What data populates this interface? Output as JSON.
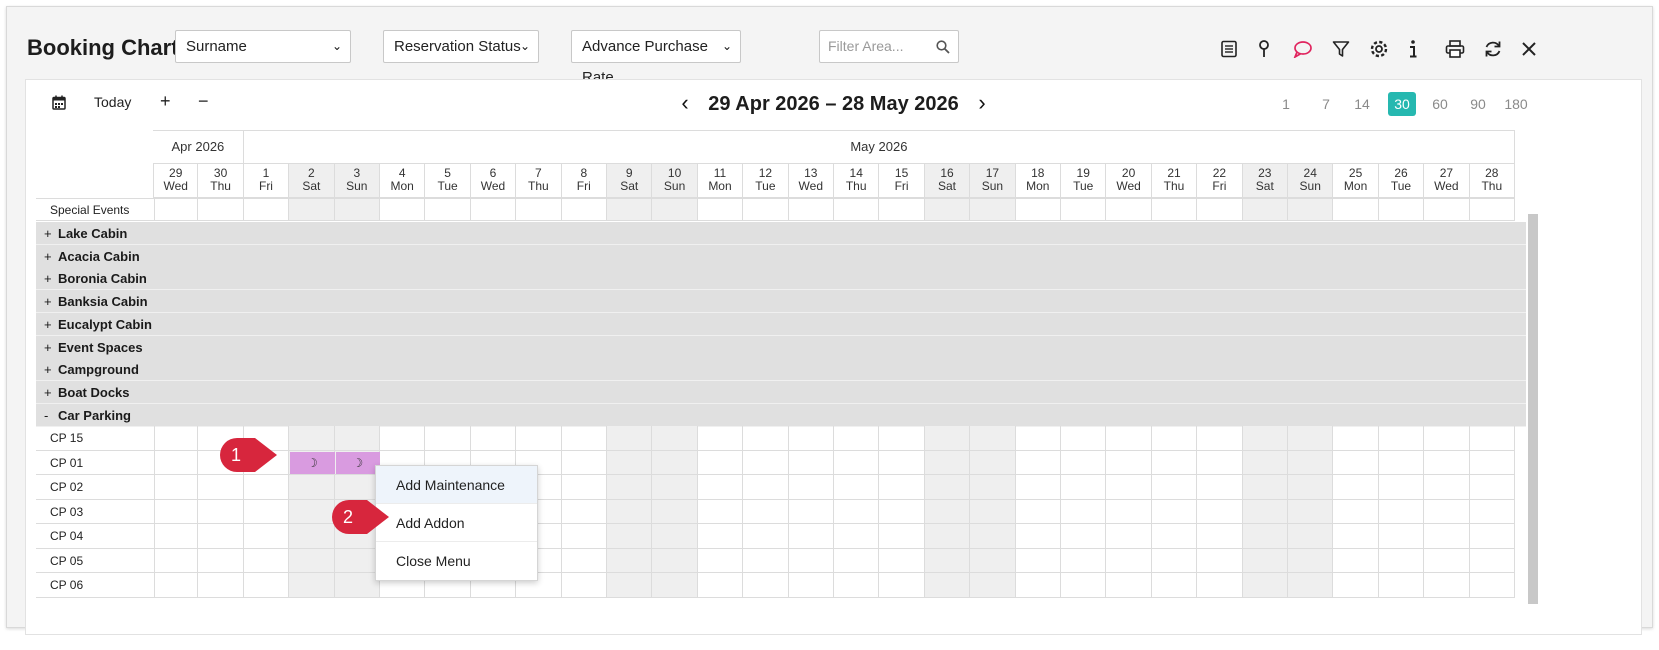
{
  "app": {
    "title": "Booking Chart"
  },
  "toolbar": {
    "filter1": "Surname",
    "filter2": "Reservation Status",
    "filter3": "Advance Purchase Rate",
    "area_placeholder": "Filter Area...",
    "icons": [
      "list-icon",
      "pin-icon",
      "comment-icon",
      "filter-icon",
      "gear-icon",
      "info-icon",
      "print-icon",
      "refresh-icon",
      "close-icon"
    ]
  },
  "nav": {
    "today": "Today",
    "plus": "+",
    "minus": "−",
    "prev": "‹",
    "next": "›",
    "range": "29 Apr 2026 – 28 May 2026",
    "zoom": [
      "1",
      "7",
      "14",
      "30",
      "60",
      "90",
      "180"
    ],
    "zoom_active": "30"
  },
  "months": [
    "Apr 2026",
    "May 2026"
  ],
  "days": [
    [
      "29",
      "Wed"
    ],
    [
      "30",
      "Thu"
    ],
    [
      "1",
      "Fri"
    ],
    [
      "2",
      "Sat"
    ],
    [
      "3",
      "Sun"
    ],
    [
      "4",
      "Mon"
    ],
    [
      "5",
      "Tue"
    ],
    [
      "6",
      "Wed"
    ],
    [
      "7",
      "Thu"
    ],
    [
      "8",
      "Fri"
    ],
    [
      "9",
      "Sat"
    ],
    [
      "10",
      "Sun"
    ],
    [
      "11",
      "Mon"
    ],
    [
      "12",
      "Tue"
    ],
    [
      "13",
      "Wed"
    ],
    [
      "14",
      "Thu"
    ],
    [
      "15",
      "Fri"
    ],
    [
      "16",
      "Sat"
    ],
    [
      "17",
      "Sun"
    ],
    [
      "18",
      "Mon"
    ],
    [
      "19",
      "Tue"
    ],
    [
      "20",
      "Wed"
    ],
    [
      "21",
      "Thu"
    ],
    [
      "22",
      "Fri"
    ],
    [
      "23",
      "Sat"
    ],
    [
      "24",
      "Sun"
    ],
    [
      "25",
      "Mon"
    ],
    [
      "26",
      "Tue"
    ],
    [
      "27",
      "Wed"
    ],
    [
      "28",
      "Thu"
    ]
  ],
  "special_events": "Special Events",
  "categories": [
    {
      "sign": "+",
      "label": "Lake Cabin"
    },
    {
      "sign": "+",
      "label": "Acacia Cabin"
    },
    {
      "sign": "+",
      "label": "Boronia Cabin"
    },
    {
      "sign": "+",
      "label": "Banksia Cabin"
    },
    {
      "sign": "+",
      "label": "Eucalypt Cabin"
    },
    {
      "sign": "+",
      "label": "Event Spaces"
    },
    {
      "sign": "+",
      "label": "Campground"
    },
    {
      "sign": "+",
      "label": "Boat Docks"
    },
    {
      "sign": "-",
      "label": "Car Parking"
    }
  ],
  "units": [
    "CP 15",
    "CP 01",
    "CP 02",
    "CP 03",
    "CP 04",
    "CP 05",
    "CP 06"
  ],
  "booking": {
    "glyph": "☽",
    "color": "#d99be0"
  },
  "context_menu": [
    "Add Maintenance",
    "Add Addon",
    "Close Menu"
  ],
  "badges": [
    "1",
    "2"
  ],
  "colors": {
    "accent": "#26b8b0",
    "badge": "#d7263d",
    "weekend": "#efefef",
    "category": "#e0e0e0"
  }
}
